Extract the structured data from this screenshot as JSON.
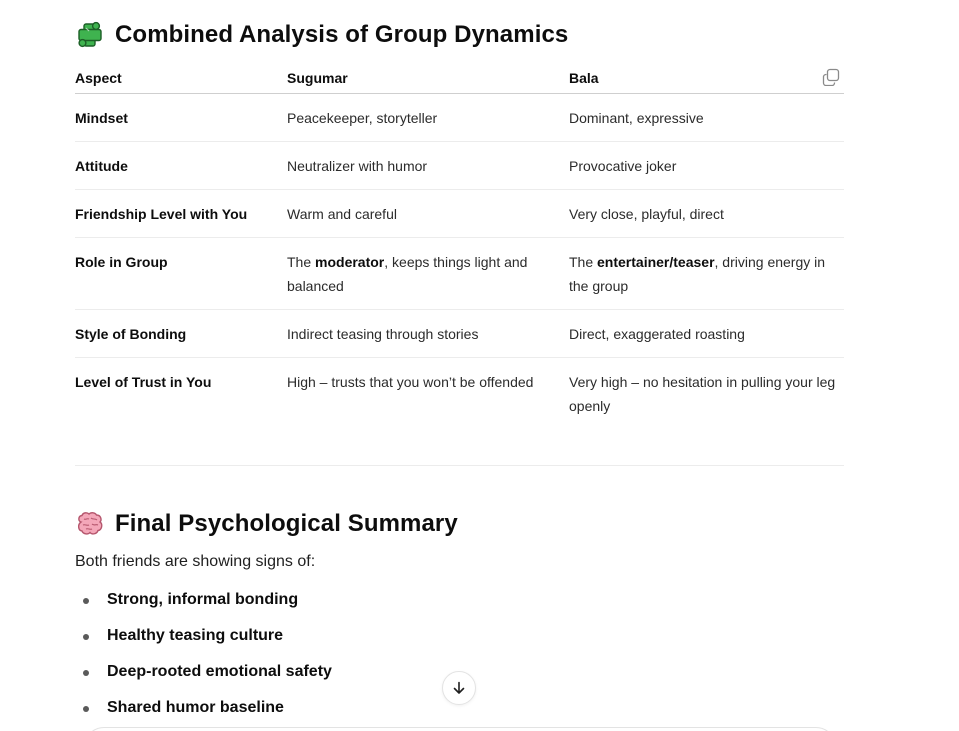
{
  "section1": {
    "emoji": "puzzle-piece-emoji",
    "title": "Combined Analysis of Group Dynamics"
  },
  "table": {
    "headers": [
      "Aspect",
      "Sugumar",
      "Bala"
    ],
    "copy_icon": "copy-icon",
    "rows": [
      {
        "aspect": "Mindset",
        "sugumar": "Peacekeeper, storyteller",
        "bala": "Dominant, expressive"
      },
      {
        "aspect": "Attitude",
        "sugumar": "Neutralizer with humor",
        "bala": "Provocative joker"
      },
      {
        "aspect": "Friendship Level with You",
        "sugumar": "Warm and careful",
        "bala": "Very close, playful, direct"
      },
      {
        "aspect": "Role in Group",
        "sugumar_pre": "The ",
        "sugumar_bold": "moderator",
        "sugumar_post": ", keeps things light and balanced",
        "bala_pre": "The ",
        "bala_bold": "entertainer/teaser",
        "bala_post": ", driving energy in the group"
      },
      {
        "aspect": "Style of Bonding",
        "sugumar": "Indirect teasing through stories",
        "bala": "Direct, exaggerated roasting"
      },
      {
        "aspect": "Level of Trust in You",
        "sugumar": "High – trusts that you won’t be offended",
        "bala": "Very high – no hesitation in pulling your leg openly"
      }
    ]
  },
  "section2": {
    "emoji": "brain-emoji",
    "title": "Final Psychological Summary",
    "intro": "Both friends are showing signs of:",
    "bullets": [
      "Strong, informal bonding",
      "Healthy teasing culture",
      "Deep-rooted emotional safety",
      "Shared humor baseline"
    ]
  },
  "scroll_button": {
    "icon": "arrow-down-icon"
  },
  "colors": {
    "puzzle_green": "#3fb34f",
    "brain_pink": "#f4a7b9",
    "text_primary": "#0d0d0d",
    "text_secondary": "#2b2b2b",
    "row_border": "#ececec"
  }
}
